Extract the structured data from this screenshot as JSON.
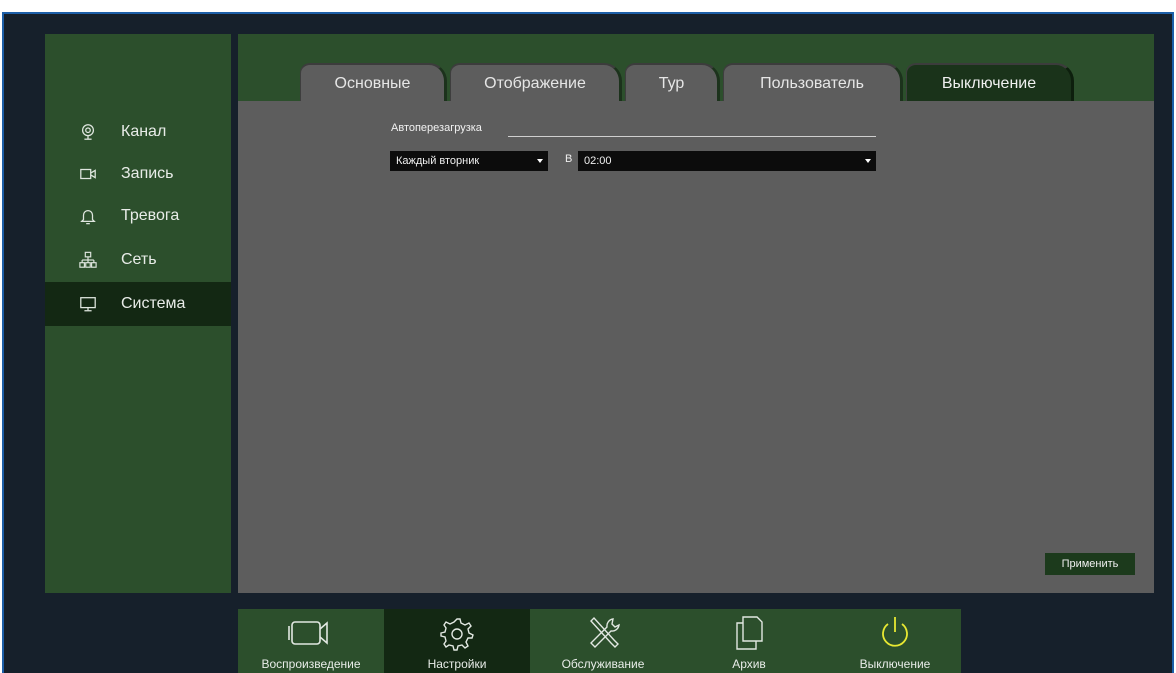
{
  "sidebar": {
    "items": [
      {
        "label": "Канал",
        "icon": "camera-dome-icon"
      },
      {
        "label": "Запись",
        "icon": "video-record-icon"
      },
      {
        "label": "Тревога",
        "icon": "bell-icon"
      },
      {
        "label": "Сеть",
        "icon": "network-icon"
      },
      {
        "label": "Система",
        "icon": "monitor-icon",
        "active": true
      }
    ]
  },
  "tabs": [
    {
      "label": "Основные"
    },
    {
      "label": "Отображение"
    },
    {
      "label": "Тур"
    },
    {
      "label": "Пользователь"
    },
    {
      "label": "Выключение",
      "active": true
    }
  ],
  "shutdown": {
    "autoreboot_label": "Автоперезагрузка",
    "schedule_value": "Каждый вторник",
    "at_label": "В",
    "time_value": "02:00",
    "apply_label": "Применить"
  },
  "bottom_bar": {
    "items": [
      {
        "label": "Воспроизведение",
        "icon": "video-camera-icon"
      },
      {
        "label": "Настройки",
        "icon": "gear-icon",
        "active": true
      },
      {
        "label": "Обслуживание",
        "icon": "tools-icon"
      },
      {
        "label": "Архив",
        "icon": "documents-icon"
      },
      {
        "label": "Выключение",
        "icon": "power-icon"
      }
    ]
  },
  "colors": {
    "frame_background": "#16202b",
    "panel_green": "#2c4f2c",
    "active_green": "#132813",
    "content_gray": "#5d5d5d",
    "power_icon_yellow": "#e8e832",
    "frame_border_blue": "#1d5fa8"
  }
}
